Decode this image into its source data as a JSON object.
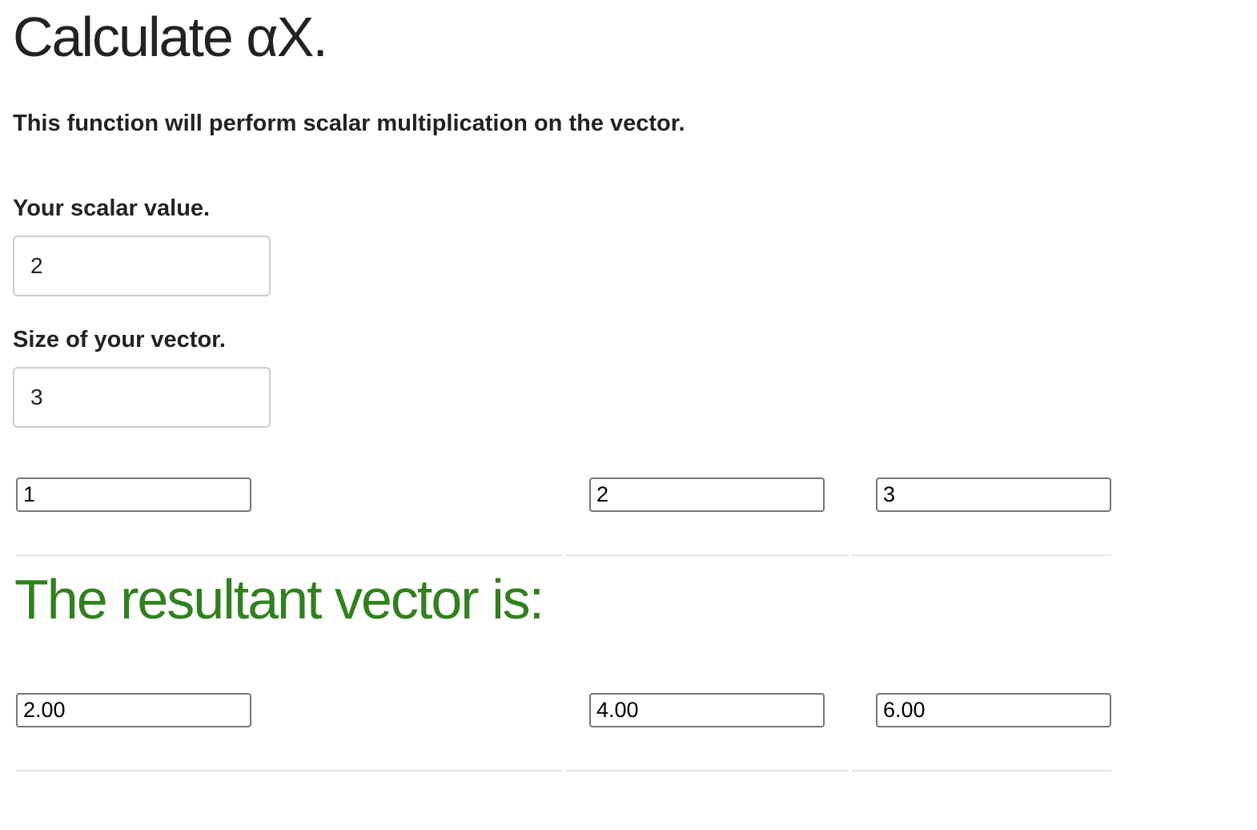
{
  "header": {
    "title": "Calculate αX.",
    "description": "This function will perform scalar multiplication on the vector."
  },
  "form": {
    "scalar_label": "Your scalar value.",
    "scalar_value": "2",
    "size_label": "Size of your vector.",
    "size_value": "3"
  },
  "vector": {
    "inputs": [
      "1",
      "2",
      "3"
    ]
  },
  "result": {
    "heading": "The resultant vector is:",
    "heading_color": "#31801f",
    "values": [
      "2.00",
      "4.00",
      "6.00"
    ]
  }
}
